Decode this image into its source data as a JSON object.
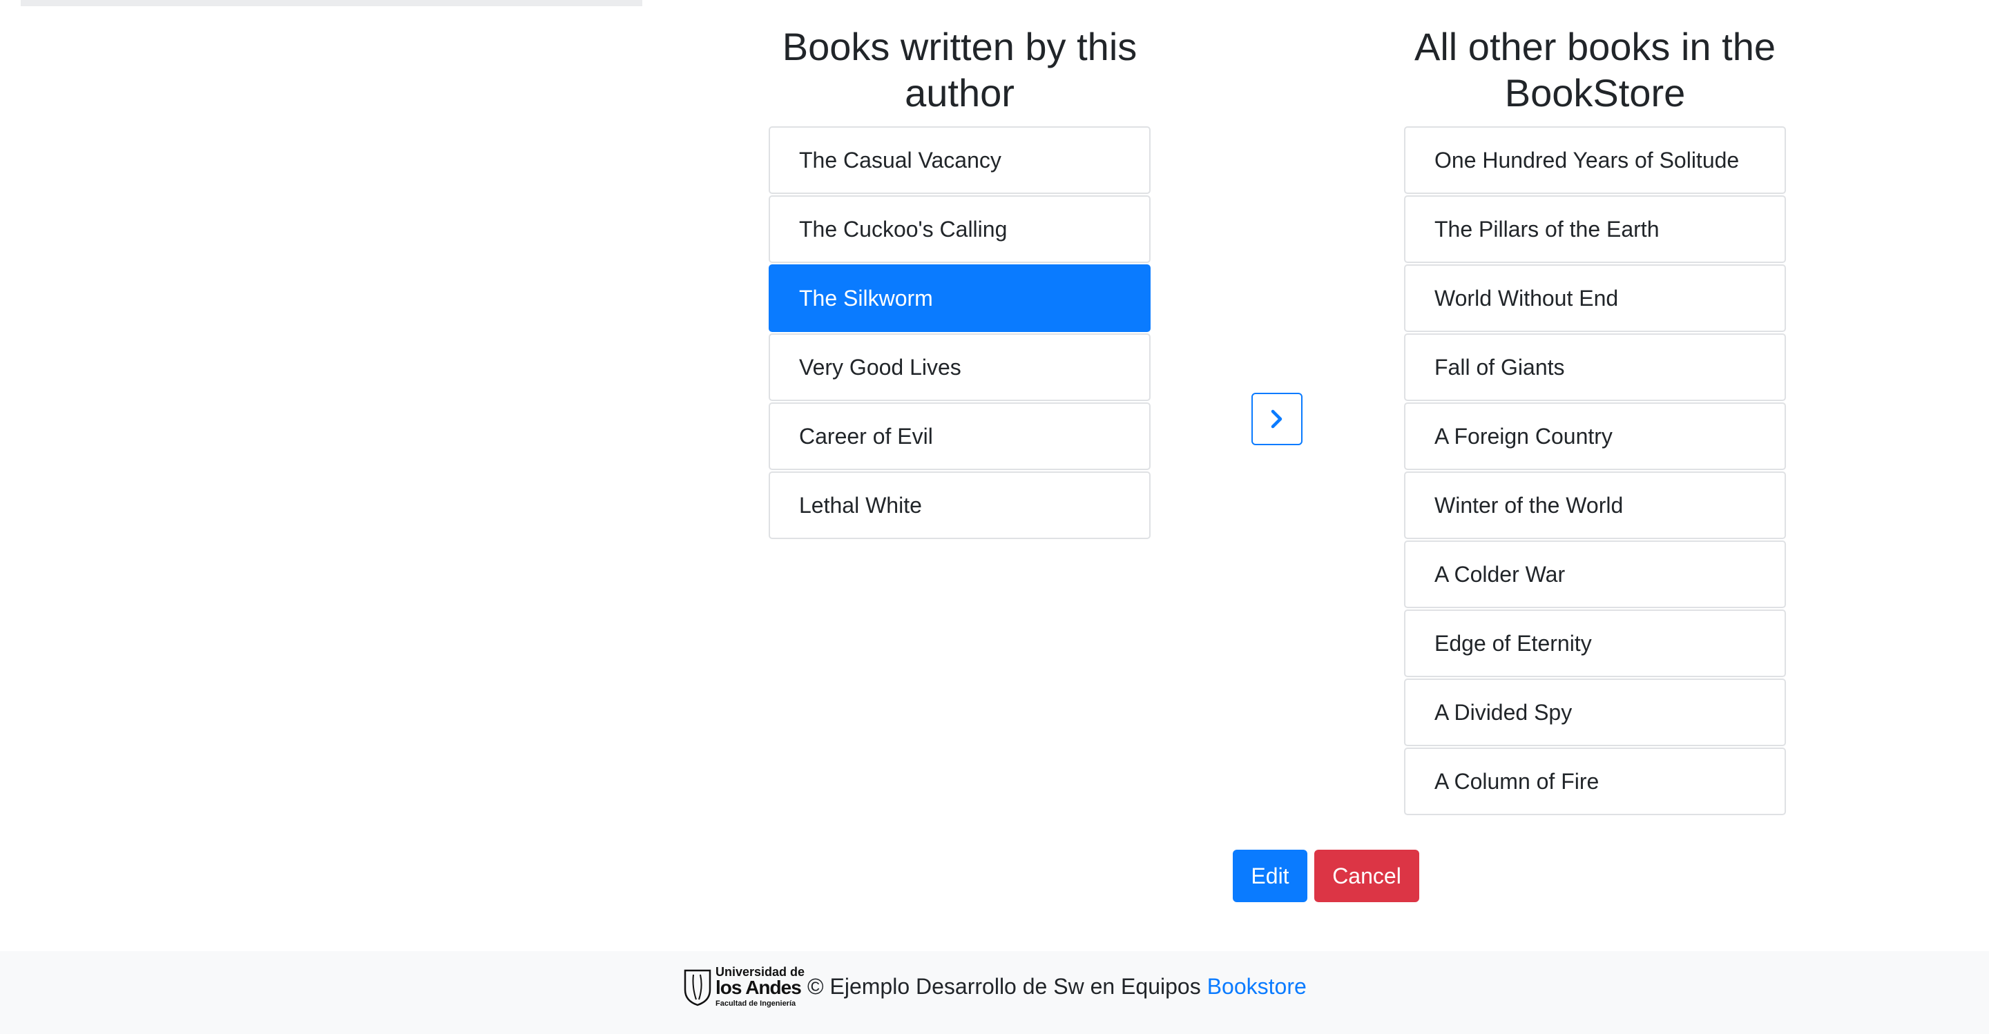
{
  "author_books": {
    "heading": "Books written by this author",
    "selected_index": 2,
    "items": [
      "The Casual Vacancy",
      "The Cuckoo's Calling",
      "The Silkworm",
      "Very Good Lives",
      "Career of Evil",
      "Lethal White"
    ]
  },
  "other_books": {
    "heading": "All other books in the BookStore",
    "items": [
      "One Hundred Years of Solitude",
      "The Pillars of the Earth",
      "World Without End",
      "Fall of Giants",
      "A Foreign Country",
      "Winter of the World",
      "A Colder War",
      "Edge of Eternity",
      "A Divided Spy",
      "A Column of Fire"
    ]
  },
  "move_button": {
    "icon": "chevron-right-icon"
  },
  "actions": {
    "edit_label": "Edit",
    "cancel_label": "Cancel"
  },
  "footer": {
    "logo": {
      "line1": "Universidad de",
      "line2": "los Andes",
      "line3": "Facultad de Ingeniería"
    },
    "copyright_text": "© Ejemplo Desarrollo de Sw en Equipos",
    "link_text": "Bookstore"
  },
  "colors": {
    "primary": "#0a7bff",
    "danger": "#dc3545",
    "footer_bg": "#f8f9fa",
    "list_border": "#dfe1e4"
  }
}
